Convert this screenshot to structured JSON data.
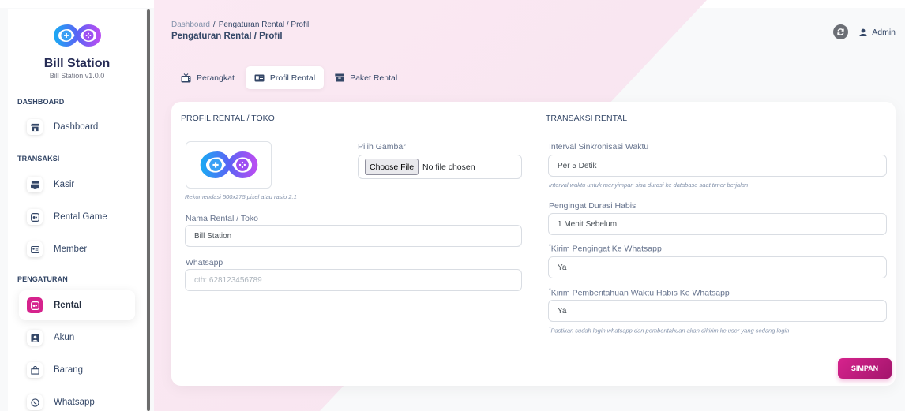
{
  "brand": {
    "name": "Bill Station",
    "version": "Bill Station v1.0.0"
  },
  "sidebar": {
    "sections": [
      {
        "title": "DASHBOARD",
        "items": [
          {
            "label": "Dashboard",
            "icon": "store-icon"
          }
        ]
      },
      {
        "title": "TRANSAKSI",
        "items": [
          {
            "label": "Kasir",
            "icon": "cashier-icon"
          },
          {
            "label": "Rental Game",
            "icon": "gamepad-icon"
          },
          {
            "label": "Member",
            "icon": "member-card-icon"
          }
        ]
      },
      {
        "title": "PENGATURAN",
        "items": [
          {
            "label": "Rental",
            "icon": "gamepad-icon",
            "active": true
          },
          {
            "label": "Akun",
            "icon": "user-circle-icon"
          },
          {
            "label": "Barang",
            "icon": "bag-icon"
          },
          {
            "label": "Whatsapp",
            "icon": "whatsapp-icon"
          }
        ]
      }
    ],
    "active_color": "#d6238d"
  },
  "header": {
    "breadcrumb_root": "Dashboard",
    "breadcrumb_sep": "/",
    "breadcrumb_current": "Pengaturan Rental / Profil",
    "title": "Pengaturan Rental / Profil",
    "user": "Admin"
  },
  "tabs": [
    {
      "label": "Perangkat",
      "icon": "tv-icon"
    },
    {
      "label": "Profil Rental",
      "icon": "id-card-icon",
      "active": true
    },
    {
      "label": "Paket Rental",
      "icon": "box-icon"
    }
  ],
  "profile": {
    "section_title": "PROFIL RENTAL / TOKO",
    "image_hint": "Rekomendasi 500x275 pixel atau rasio 2:1",
    "pick_image_label": "Pilih Gambar",
    "choose_file_button": "Choose File",
    "file_status": "No file chosen",
    "name_label": "Nama Rental / Toko",
    "name_value": "Bill Station",
    "whatsapp_label": "Whatsapp",
    "whatsapp_placeholder": "cth: 628123456789"
  },
  "transaction": {
    "section_title": "TRANSAKSI RENTAL",
    "sync_label": "Interval Sinkronisasi Waktu",
    "sync_value": "Per 5 Detik",
    "sync_hint": "Interval waktu untuk menyimpan sisa durasi ke database saat timer berjalan",
    "reminder_label": "Pengingat Durasi Habis",
    "reminder_value": "1 Menit Sebelum",
    "wa_reminder_label": "Kirim Pengingat Ke Whatsapp",
    "wa_reminder_value": "Ya",
    "wa_expired_label": "Kirim Pemberitahuan Waktu Habis Ke Whatsapp",
    "wa_expired_value": "Ya",
    "asterisk": "*",
    "footnote": "Pastikan sudah login whatsapp dan pemberitahuan akan dikirim ke user yang sedang login"
  },
  "save_button": "SIMPAN"
}
